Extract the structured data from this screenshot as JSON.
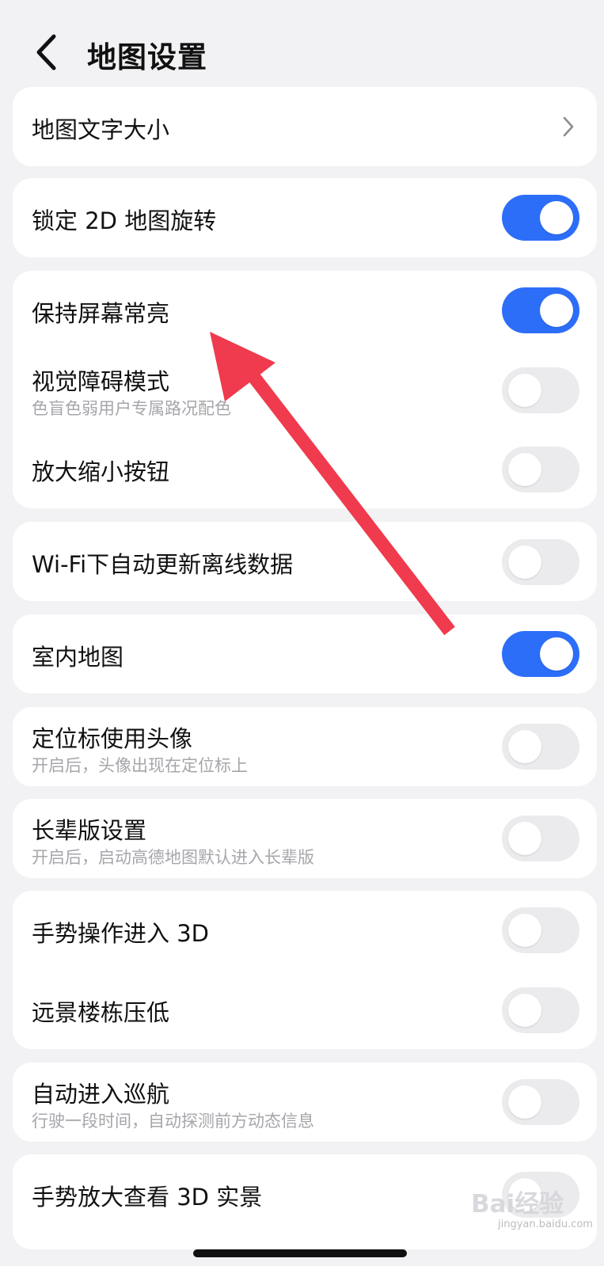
{
  "header": {
    "title": "地图设置",
    "back_icon": "chevron-left-icon"
  },
  "items": {
    "map_text_size": {
      "label": "地图文字大小"
    },
    "lock_2d_rotation": {
      "label": "锁定 2D 地图旋转",
      "on": true
    },
    "keep_screen_on": {
      "label": "保持屏幕常亮",
      "on": true
    },
    "visual_impairment": {
      "label": "视觉障碍模式",
      "sub": "色盲色弱用户专属路况配色",
      "on": false
    },
    "zoom_buttons": {
      "label": "放大缩小按钮",
      "on": false
    },
    "wifi_auto_update": {
      "label": "Wi-Fi下自动更新离线数据",
      "on": false
    },
    "indoor_map": {
      "label": "室内地图",
      "on": true
    },
    "avatar_locator": {
      "label": "定位标使用头像",
      "sub": "开启后，头像出现在定位标上",
      "on": false
    },
    "elder_mode": {
      "label": "长辈版设置",
      "sub": "开启后，启动高德地图默认进入长辈版",
      "on": false
    },
    "gesture_3d": {
      "label": "手势操作进入 3D",
      "on": false
    },
    "lower_distant_buildings": {
      "label": "远景楼栋压低",
      "on": false
    },
    "auto_cruise": {
      "label": "自动进入巡航",
      "sub": "行驶一段时间，自动探测前方动态信息",
      "on": false
    },
    "gesture_zoom_3d": {
      "label": "手势放大查看 3D 实景",
      "on": false
    }
  },
  "colors": {
    "accent": "#2d6ef8",
    "toggle_off": "#ebebee",
    "annotation_arrow": "#f03a4d",
    "background": "#f2f2f4"
  },
  "watermark": {
    "brand": "Bai经验",
    "site": "jingyan.baidu.com"
  }
}
